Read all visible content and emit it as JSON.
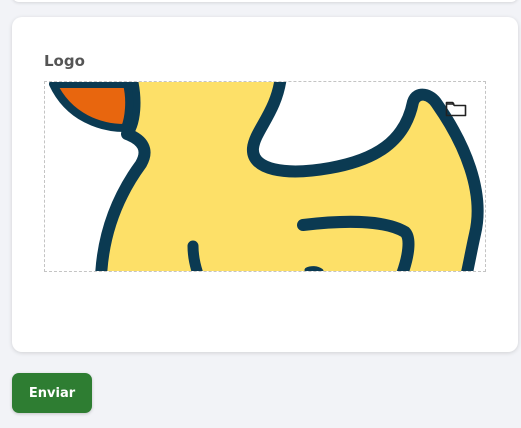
{
  "form": {
    "logo_label": "Logo",
    "submit_label": "Enviar"
  },
  "colors": {
    "submit_bg": "#2e7d32",
    "duck_body": "#fde068",
    "duck_outline": "#0b3a52",
    "duck_beak": "#e8660e"
  },
  "icons": {
    "upload": "folder-icon",
    "logo_image": "duck-logo"
  }
}
